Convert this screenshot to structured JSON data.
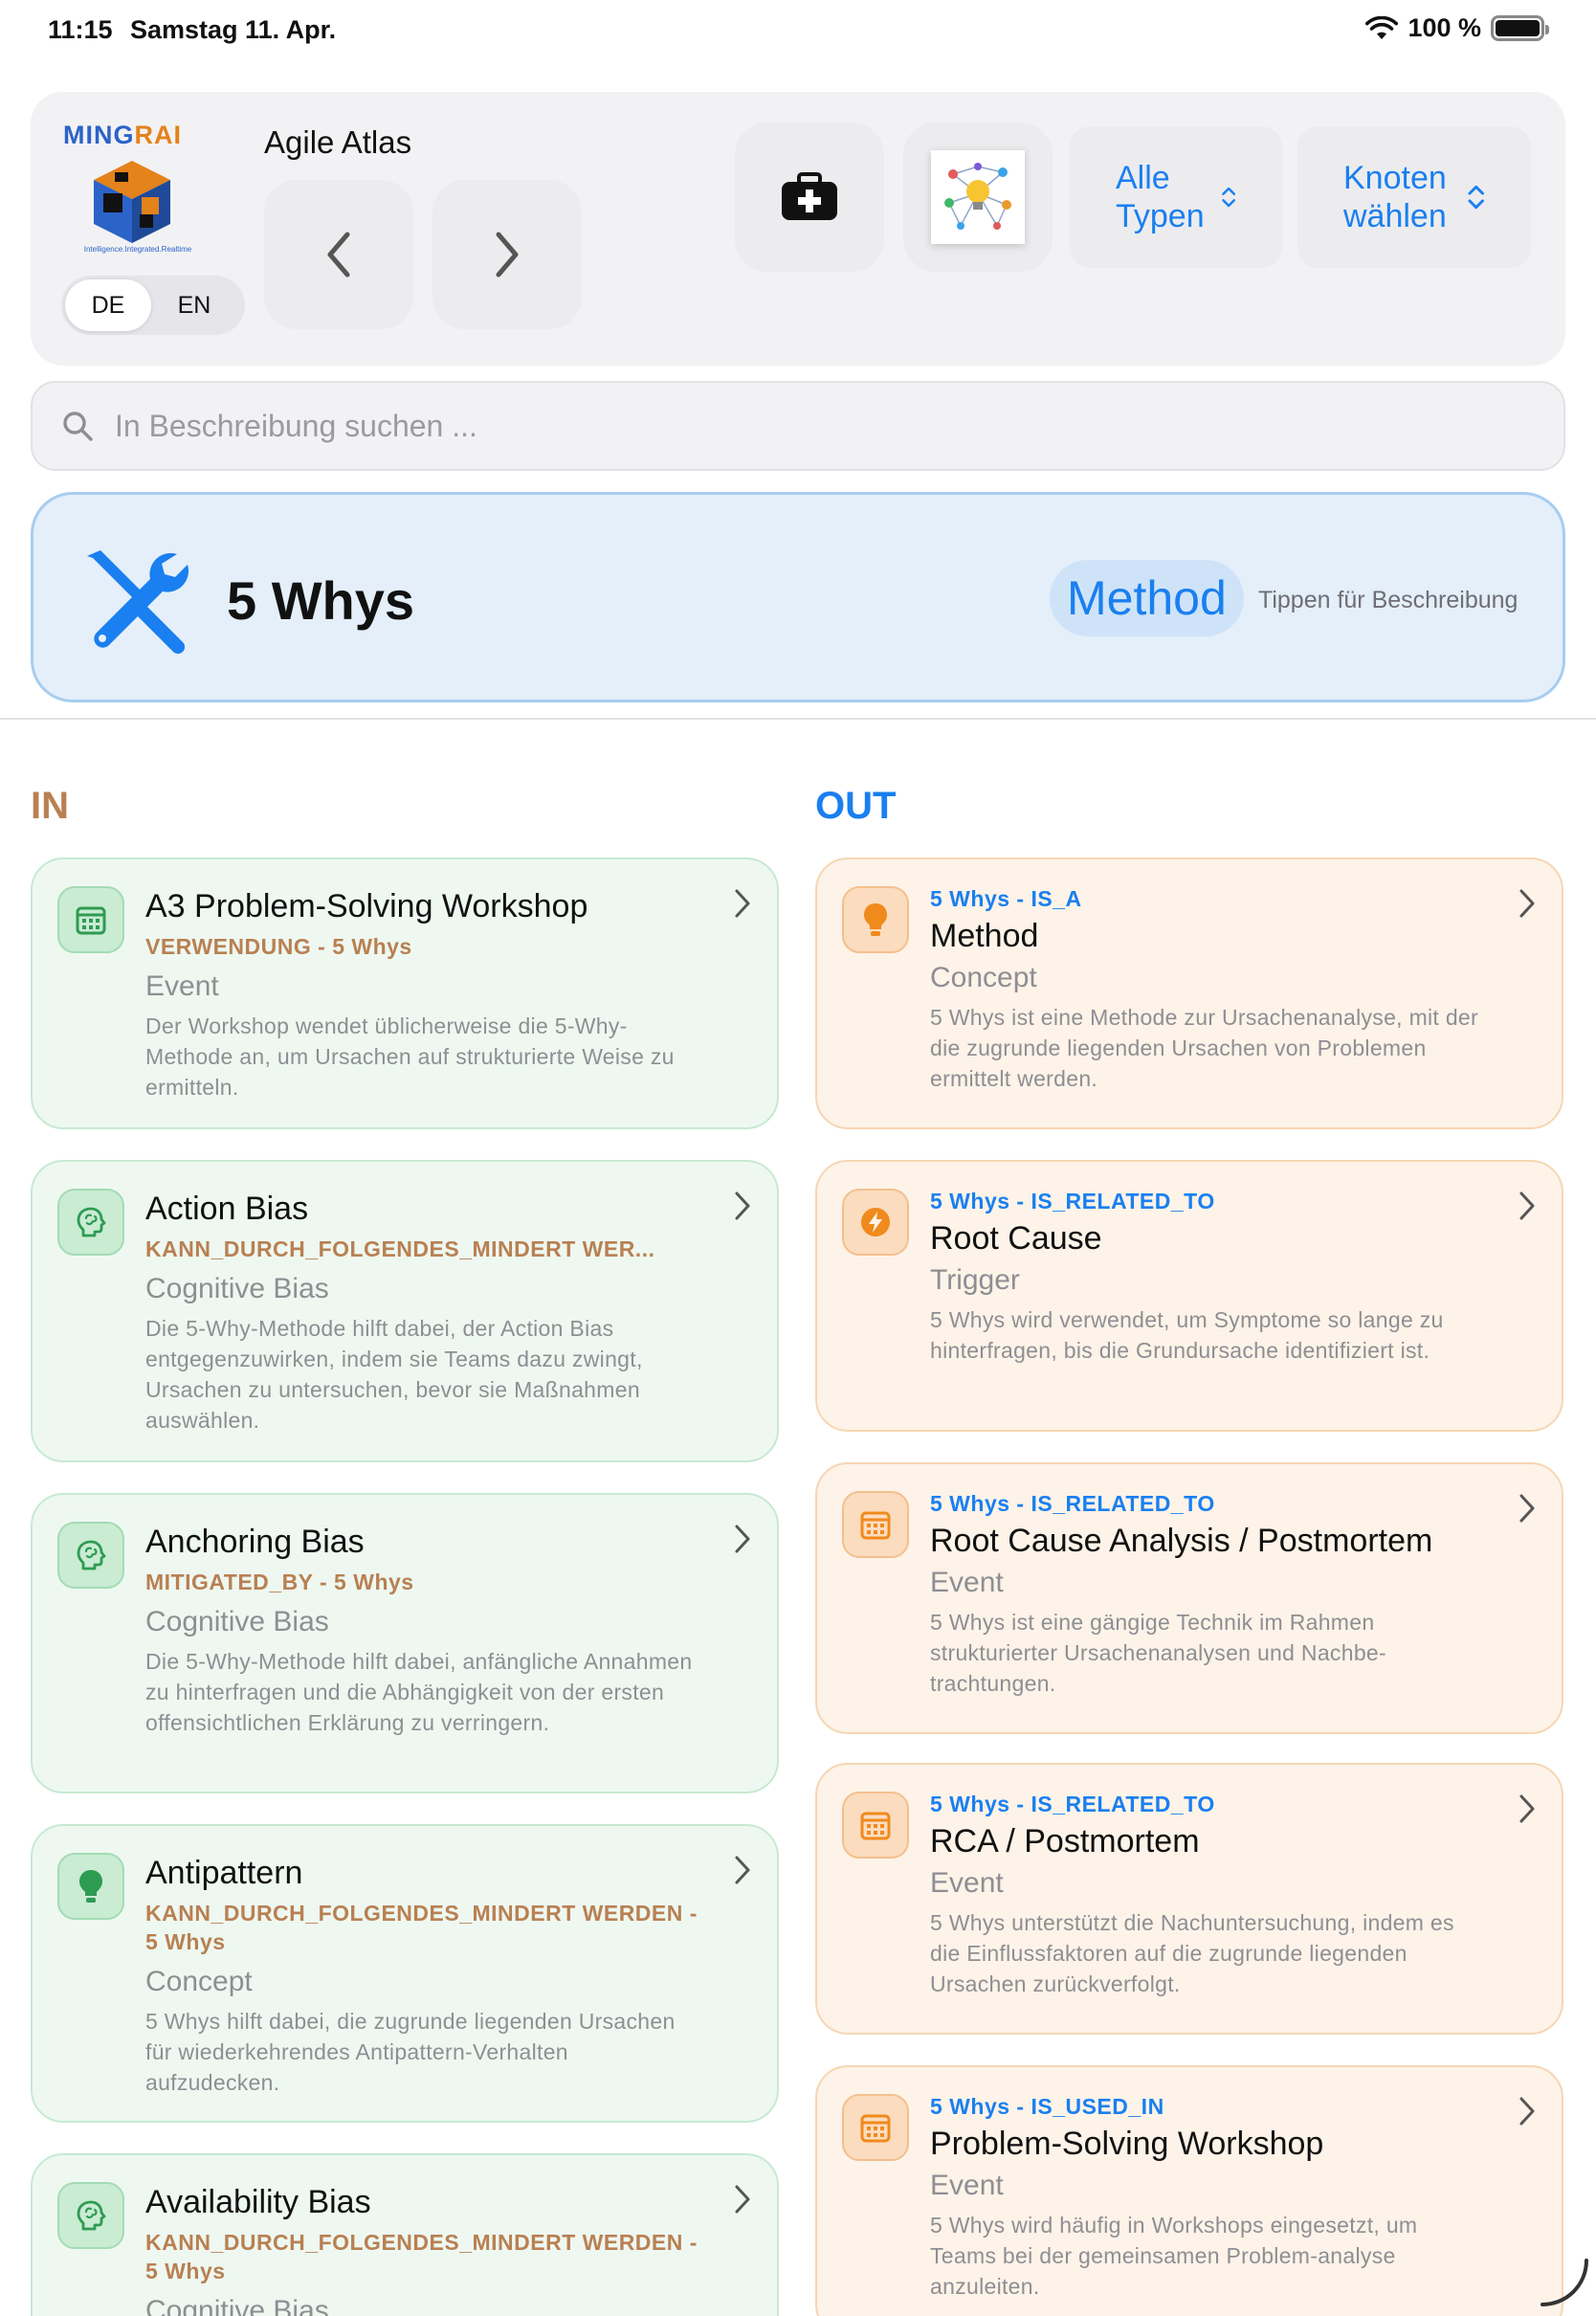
{
  "status_bar": {
    "time": "11:15",
    "date": "Samstag 11. Apr.",
    "battery": "100 %"
  },
  "header": {
    "logo_text_main": "MING",
    "logo_text_accent": "RAI",
    "logo_tagline": "Intelligence.Integrated.Realtime",
    "languages": [
      {
        "label": "DE",
        "active": true
      },
      {
        "label": "EN",
        "active": false
      }
    ],
    "app_title": "Agile Atlas",
    "types_picker": "Alle Typen",
    "nodes_picker": "Knoten wählen"
  },
  "search": {
    "placeholder": "In Beschreibung suchen ..."
  },
  "node": {
    "title": "5 Whys",
    "type": "Method",
    "hint": "Tippen für Beschreibung",
    "accent": "#1a7ff0"
  },
  "columns": {
    "in": "IN",
    "out": "OUT"
  },
  "in_relations": [
    {
      "icon": "calendar-icon",
      "title": "A3 Problem-Solving Workshop",
      "relation": "VERWENDUNG - 5 Whys",
      "type": "Event",
      "description": "Der Workshop wendet üblicherweise die 5-Why-Methode an, um Ursachen auf strukturierte Weise zu ermitteln."
    },
    {
      "icon": "brain-icon",
      "title": "Action Bias",
      "relation": "KANN_DURCH_FOLGENDES_MINDERT WER...",
      "type": "Cognitive Bias",
      "description": "Die 5-Why-Methode hilft dabei, der Action Bias entgegenzuwirken, indem sie Teams dazu zwingt, Ursachen zu untersuchen, bevor sie Maßnahmen auswählen."
    },
    {
      "icon": "brain-icon",
      "title": "Anchoring Bias",
      "relation": "MITIGATED_BY - 5 Whys",
      "type": "Cognitive Bias",
      "description": "Die 5-Why-Methode hilft dabei, anfängliche Annahmen zu hinterfragen und die Abhängigkeit von der ersten offensichtlichen Erklärung zu verringern."
    },
    {
      "icon": "lightbulb-icon",
      "title": "Antipattern",
      "relation": "KANN_DURCH_FOLGENDES_MINDERT WERDEN - 5 Whys",
      "type": "Concept",
      "description": "5 Whys hilft dabei, die zugrunde liegenden Ursachen für wiederkehrendes Antipattern-Verhalten aufzudecken."
    },
    {
      "icon": "brain-icon",
      "title": "Availability Bias",
      "relation": "KANN_DURCH_FOLGENDES_MINDERT WERDEN - 5 Whys",
      "type": "Cognitive Bias",
      "description": ""
    }
  ],
  "out_relations": [
    {
      "icon": "lightbulb-icon",
      "relation": "5 Whys - IS_A",
      "title": "Method",
      "type": "Concept",
      "description": "5 Whys ist eine Methode zur Ursachenanalyse, mit der die zugrunde liegenden Ursachen von Problemen ermittelt werden."
    },
    {
      "icon": "bolt-icon",
      "relation": "5 Whys - IS_RELATED_TO",
      "title": "Root Cause",
      "type": "Trigger",
      "description": "5 Whys wird verwendet, um Symptome so lange zu hinterfragen, bis die Grundursache identifiziert ist."
    },
    {
      "icon": "calendar-icon",
      "relation": "5 Whys - IS_RELATED_TO",
      "title": "Root Cause Analysis / Postmortem",
      "type": "Event",
      "description": "5 Whys ist eine gängige Technik im Rahmen strukturierter Ursachenanalysen und Nachbe-trachtungen."
    },
    {
      "icon": "calendar-icon",
      "relation": "5 Whys - IS_RELATED_TO",
      "title": "RCA / Postmortem",
      "type": "Event",
      "description": "5 Whys unterstützt die Nachuntersuchung, indem es die Einflussfaktoren auf die zugrunde liegenden Ursachen zurückverfolgt."
    },
    {
      "icon": "calendar-icon",
      "relation": "5 Whys - IS_USED_IN",
      "title": "Problem-Solving Workshop",
      "type": "Event",
      "description": "5 Whys wird häufig in Workshops eingesetzt, um Teams bei der gemeinsamen Problem-analyse anzuleiten."
    }
  ]
}
